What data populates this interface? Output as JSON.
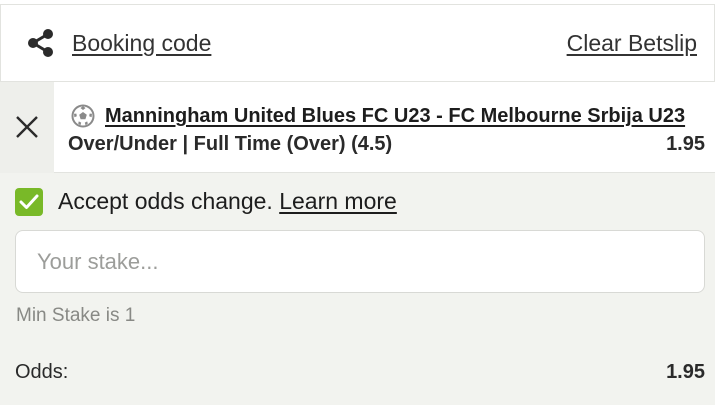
{
  "header": {
    "booking_code_label": "Booking code",
    "clear_betslip_label": "Clear Betslip"
  },
  "selection": {
    "match": "Manningham United Blues FC U23 - FC Melbourne Srbija U23",
    "market": "Over/Under | Full Time (Over) (4.5)",
    "odds": "1.95",
    "sport_icon": "football-icon"
  },
  "accept_odds": {
    "checked": true,
    "label": "Accept odds change.",
    "learn_more": "Learn more"
  },
  "stake": {
    "placeholder": "Your stake...",
    "value": "",
    "min_stake_text": "Min Stake is 1"
  },
  "summary": {
    "odds_label": "Odds:",
    "odds_value": "1.95"
  },
  "colors": {
    "accent_green": "#79b928",
    "page_background": "#f2f3ef",
    "card_background": "#ffffff"
  }
}
